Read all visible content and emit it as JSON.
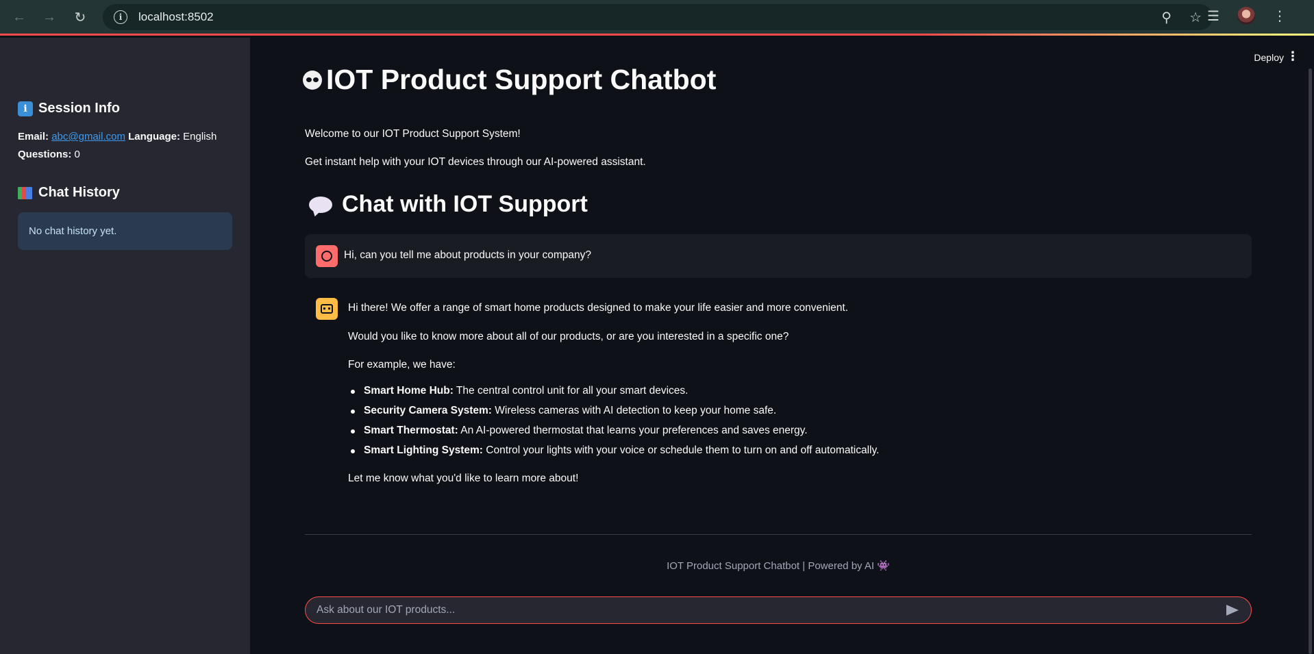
{
  "browser": {
    "url": "localhost:8502",
    "icons": [
      "back-icon",
      "forward-icon",
      "reload-icon",
      "info-icon",
      "zoom-icon",
      "star-icon",
      "media-icon",
      "profile-avatar"
    ]
  },
  "sidebar": {
    "session_title": "Session Info",
    "email_label": "Email:",
    "email_value": "abc@gmail.com",
    "language_label": "Language:",
    "language_value": "English",
    "questions_label": "Questions:",
    "questions_value": "0",
    "history_title": "Chat History",
    "history_empty": "No chat history yet."
  },
  "header": {
    "deploy_label": "Deploy"
  },
  "main": {
    "title": "IOT Product Support Chatbot",
    "welcome": "Welcome to our IOT Product Support System!",
    "description": "Get instant help with your IOT devices through our AI-powered assistant.",
    "chat_heading": "Chat with IOT Support"
  },
  "messages": {
    "user": "Hi, can you tell me about products in your company?",
    "bot_intro": "Hi there! We offer a range of smart home products designed to make your life easier and more convenient.",
    "bot_question": "Would you like to know more about all of our products, or are you interested in a specific one?",
    "bot_example": "For example, we have:",
    "products": [
      {
        "name": "Smart Home Hub:",
        "desc": " The central control unit for all your smart devices."
      },
      {
        "name": "Security Camera System:",
        "desc": " Wireless cameras with AI detection to keep your home safe."
      },
      {
        "name": "Smart Thermostat:",
        "desc": " An AI-powered thermostat that learns your preferences and saves energy."
      },
      {
        "name": "Smart Lighting System:",
        "desc": " Control your lights with your voice or schedule them to turn on and off automatically."
      }
    ],
    "bot_closing": "Let me know what you'd like to learn more about!"
  },
  "footer": {
    "text": "IOT Product Support Chatbot | Powered by AI 👾"
  },
  "input": {
    "placeholder": "Ask about our IOT products..."
  },
  "colors": {
    "accent": "#ff4b4b",
    "sidebar_bg": "#262730",
    "main_bg": "#0e1117",
    "link": "#3d9df3",
    "user_avatar": "#ff6c6c",
    "bot_avatar": "#ffbd45"
  }
}
